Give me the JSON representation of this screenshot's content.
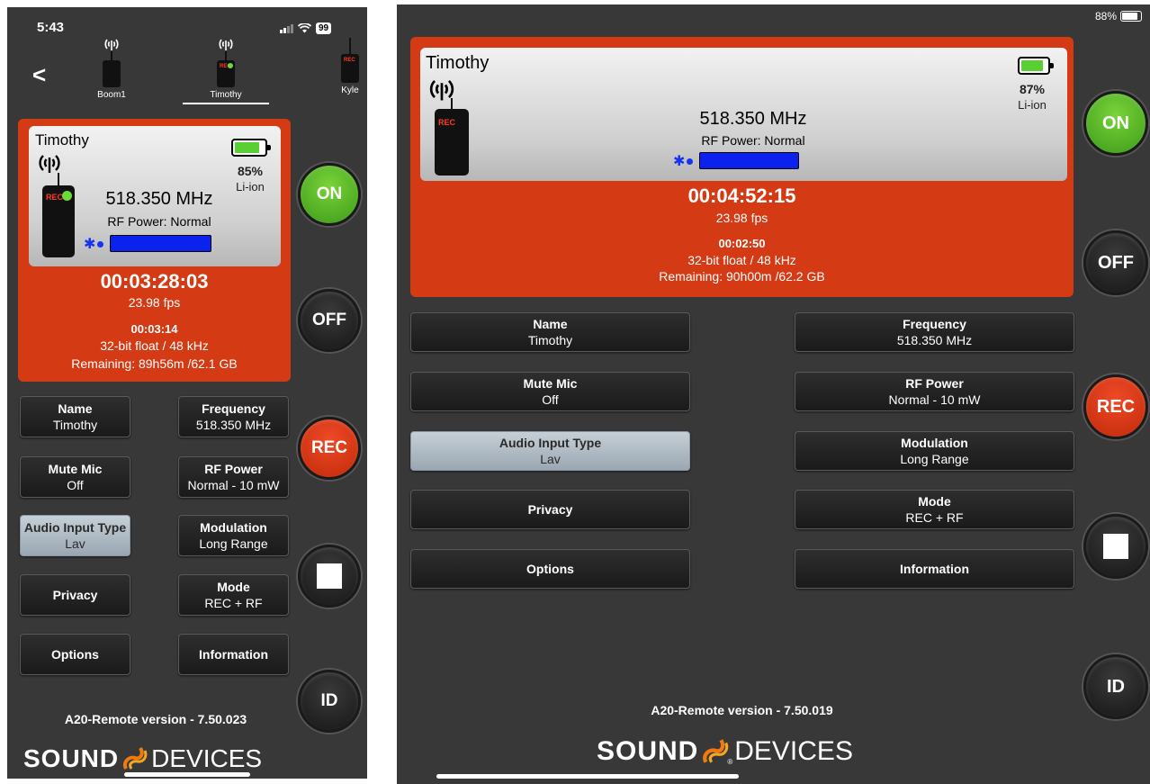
{
  "phone": {
    "status": {
      "time": "5:43",
      "battery": "99"
    },
    "back_label": "<",
    "devices": [
      {
        "label": "Boom1"
      },
      {
        "label": "Timothy",
        "rec_badge": "REC"
      },
      {
        "label": "Kyle",
        "rec_badge": "REC"
      }
    ],
    "card": {
      "name": "Timothy",
      "rec_badge": "REC",
      "frequency": "518.350 MHz",
      "rf_power": "RF Power: Normal",
      "battery_percent": "85%",
      "battery_type": "Li-ion",
      "battery_level": 0.85,
      "timecode": "00:03:28:03",
      "fps": "23.98 fps",
      "elapsed": "00:03:14",
      "format": "32-bit float / 48 kHz",
      "remaining": "Remaining: 89h56m /62.1 GB"
    },
    "buttons": [
      {
        "label": "Name",
        "value": "Timothy"
      },
      {
        "label": "Frequency",
        "value": "518.350 MHz"
      },
      {
        "label": "Mute Mic",
        "value": "Off"
      },
      {
        "label": "RF Power",
        "value": "Normal - 10 mW"
      },
      {
        "label": "Audio Input Type",
        "value": "Lav",
        "selected": true
      },
      {
        "label": "Modulation",
        "value": "Long Range"
      },
      {
        "label": "Privacy",
        "value": ""
      },
      {
        "label": "Mode",
        "value": "REC + RF"
      },
      {
        "label": "Options",
        "value": ""
      },
      {
        "label": "Information",
        "value": ""
      }
    ],
    "side": {
      "on": "ON",
      "off": "OFF",
      "rec": "REC",
      "id": "ID"
    },
    "version": "A20-Remote version - 7.50.023",
    "logo": {
      "bold": "SOUND",
      "light": "DEVICES"
    }
  },
  "tablet": {
    "status": {
      "battery": "88%"
    },
    "card": {
      "name": "Timothy",
      "rec_badge": "REC",
      "frequency": "518.350 MHz",
      "rf_power": "RF Power: Normal",
      "battery_percent": "87%",
      "battery_type": "Li-ion",
      "battery_level": 0.87,
      "timecode": "00:04:52:15",
      "fps": "23.98 fps",
      "elapsed": "00:02:50",
      "format": "32-bit float / 48 kHz",
      "remaining": "Remaining: 90h00m /62.2 GB"
    },
    "buttons": [
      {
        "label": "Name",
        "value": "Timothy"
      },
      {
        "label": "Frequency",
        "value": "518.350 MHz"
      },
      {
        "label": "Mute Mic",
        "value": "Off"
      },
      {
        "label": "RF Power",
        "value": "Normal - 10 mW"
      },
      {
        "label": "Audio Input Type",
        "value": "Lav",
        "selected": true
      },
      {
        "label": "Modulation",
        "value": "Long Range"
      },
      {
        "label": "Privacy",
        "value": ""
      },
      {
        "label": "Mode",
        "value": "REC + RF"
      },
      {
        "label": "Options",
        "value": ""
      },
      {
        "label": "Information",
        "value": ""
      }
    ],
    "side": {
      "on": "ON",
      "off": "OFF",
      "rec": "REC",
      "id": "ID"
    },
    "version": "A20-Remote version - 7.50.019",
    "logo": {
      "bold": "SOUND",
      "light": "DEVICES",
      "reg": "®"
    }
  },
  "colors": {
    "card": "#d43a14",
    "on": "#5ab52a",
    "rec": "#e03a18",
    "bt": "#0b21ee"
  }
}
